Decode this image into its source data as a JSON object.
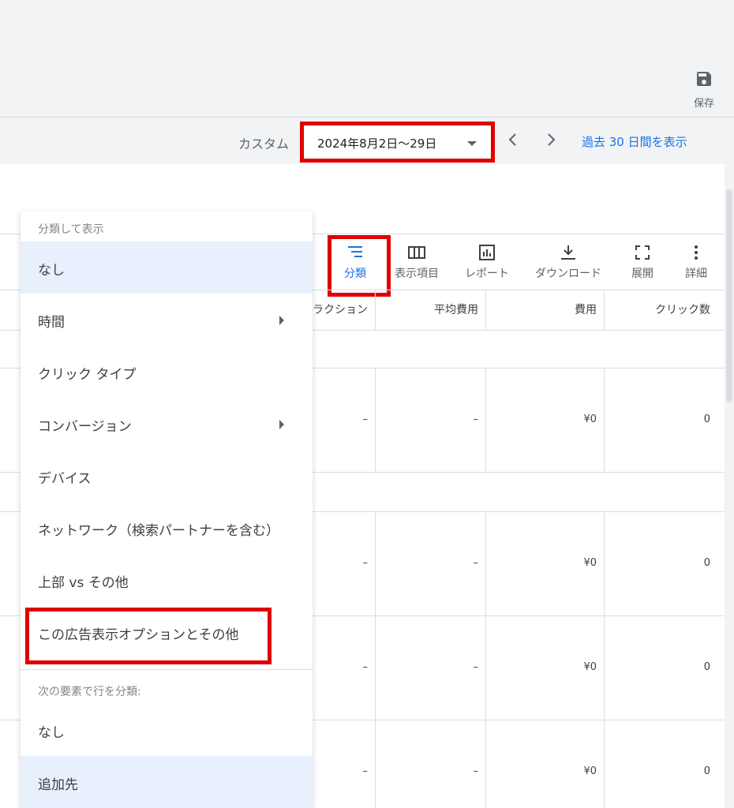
{
  "top_bar": {
    "save_label": "保存"
  },
  "date_bar": {
    "custom_label": "カスタム",
    "date_range": "2024年8月2日〜29日",
    "last30_link": "過去 30 日間を表示"
  },
  "toolbar": {
    "items": [
      {
        "label": "分類",
        "icon": "segment-icon"
      },
      {
        "label": "表示項目",
        "icon": "columns-icon"
      },
      {
        "label": "レポート",
        "icon": "report-icon"
      },
      {
        "label": "ダウンロード",
        "icon": "download-icon"
      },
      {
        "label": "展開",
        "icon": "expand-icon"
      },
      {
        "label": "詳細",
        "icon": "more-vert-icon"
      }
    ]
  },
  "table": {
    "headers": [
      "ラクション",
      "平均費用",
      "費用",
      "クリック数"
    ],
    "rows": [
      {
        "interactions": "–",
        "avg_cost": "–",
        "cost": "¥0",
        "clicks": "0"
      },
      {
        "interactions": "–",
        "avg_cost": "–",
        "cost": "¥0",
        "clicks": "0"
      },
      {
        "interactions": "–",
        "avg_cost": "–",
        "cost": "¥0",
        "clicks": "0"
      },
      {
        "interactions": "–",
        "avg_cost": "–",
        "cost": "¥0",
        "clicks": "0"
      }
    ]
  },
  "segment_menu": {
    "heading": "分類して表示",
    "items": [
      {
        "label": "なし",
        "selected": true
      },
      {
        "label": "時間",
        "submenu": true
      },
      {
        "label": "クリック タイプ"
      },
      {
        "label": "コンバージョン",
        "submenu": true
      },
      {
        "label": "デバイス"
      },
      {
        "label": "ネットワーク（検索パートナーを含む）"
      },
      {
        "label": "上部 vs その他"
      },
      {
        "label": "この広告表示オプションとその他"
      }
    ],
    "row_heading": "次の要素で行を分類:",
    "row_items": [
      {
        "label": "なし"
      },
      {
        "label": "追加先",
        "selected": true
      }
    ]
  },
  "colors": {
    "accent": "#1a73e8",
    "highlight": "#e00000",
    "selected_bg": "#e8f0fe"
  }
}
